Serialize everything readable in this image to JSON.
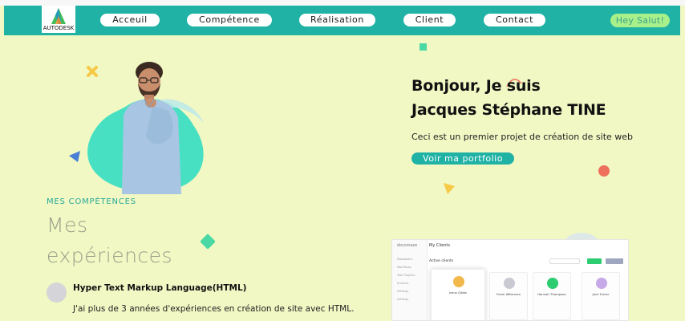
{
  "logo": {
    "text": "AUTODESK"
  },
  "nav": {
    "items": [
      {
        "label": "Acceuil"
      },
      {
        "label": "Compétence"
      },
      {
        "label": "Réalisation"
      },
      {
        "label": "Client"
      },
      {
        "label": "Contact"
      }
    ],
    "greeting": "Hey Salut!"
  },
  "hero": {
    "line1": "Bonjour, Je suis",
    "line2": "Jacques Stéphane TINE",
    "subtitle": "Ceci est un premier projet de création de site web",
    "cta": "Voir ma portfolio"
  },
  "skills": {
    "eyebrow": "MES COMPÉTENCES",
    "title_line1": "Mes",
    "title_line2": "expériences",
    "items": [
      {
        "name": "Hyper Text Markup Language(HTML)",
        "desc": "J'ai plus de 3 années d'expériences en création de site avec HTML."
      }
    ]
  },
  "dashboard": {
    "logo": "docsmaze",
    "header": "My Clients",
    "subheader": "Active clients",
    "sidebar": [
      "Dashboard",
      "Workflows",
      "Task Projects",
      "Invoices",
      "Settings",
      "Settings"
    ],
    "cards": [
      {
        "name": "Jesus Gibbs"
      },
      {
        "name": "Frank Wilkerson"
      },
      {
        "name": "Hannah Thompson"
      },
      {
        "name": "Jack Turner"
      }
    ]
  },
  "colors": {
    "page_bg": "#f1f8c4",
    "nav_bg": "#1fb2a5",
    "accent_teal": "#1fb2a5",
    "blob_teal": "#48e0c2",
    "hey_bg": "#a8f08a",
    "coral": "#ee6f5c",
    "yellow": "#f7c948"
  },
  "icons": [
    "autodesk-logo-icon",
    "cross-shape-icon",
    "triangle-shape-icon",
    "diamond-shape-icon",
    "square-shape-icon",
    "circle-shape-icon",
    "person-photo"
  ]
}
